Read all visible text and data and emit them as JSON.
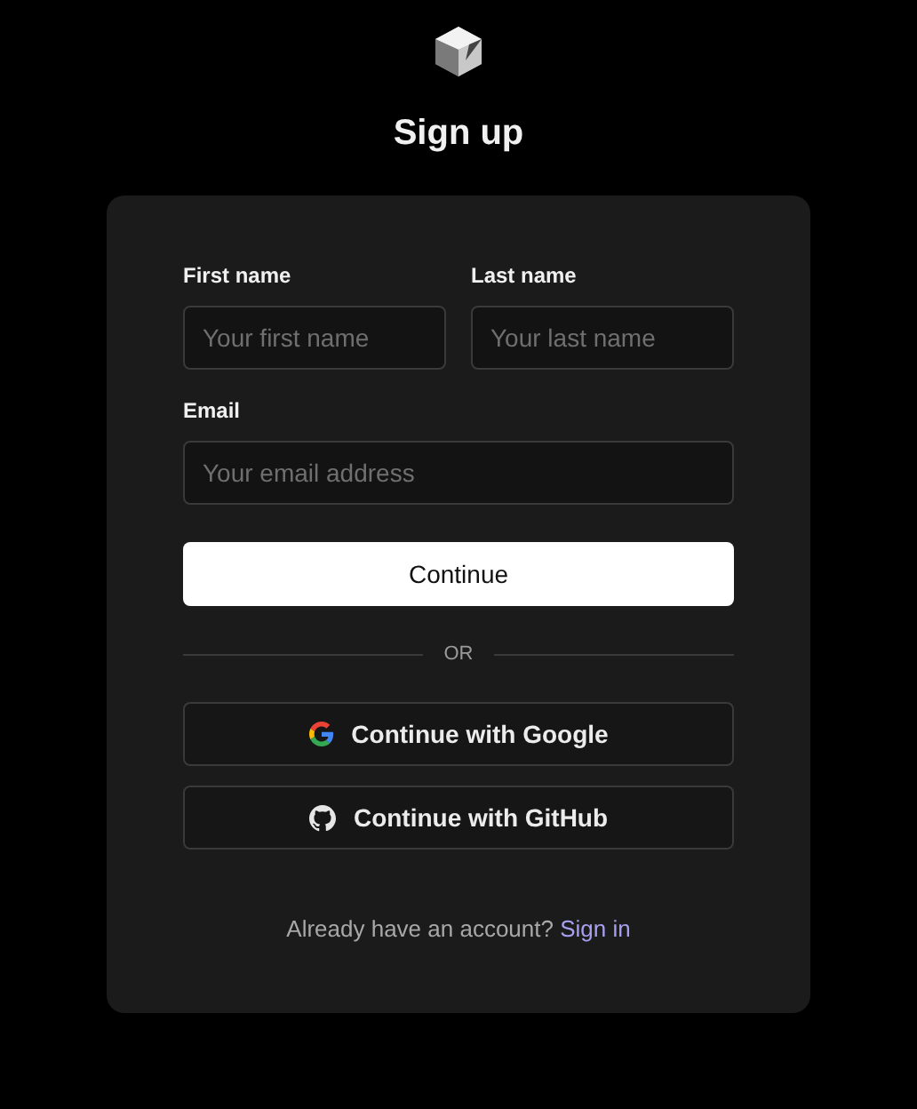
{
  "title": "Sign up",
  "fields_row": [
    {
      "label": "First name",
      "placeholder": "Your first name"
    },
    {
      "label": "Last name",
      "placeholder": "Your last name"
    }
  ],
  "email": {
    "label": "Email",
    "placeholder": "Your email address"
  },
  "submit": "Continue",
  "divider": "OR",
  "providers": [
    {
      "kind": "google",
      "label": "Continue with Google"
    },
    {
      "kind": "github",
      "label": "Continue with GitHub"
    }
  ],
  "footer": {
    "text": "Already have an account?",
    "link": "Sign in"
  }
}
